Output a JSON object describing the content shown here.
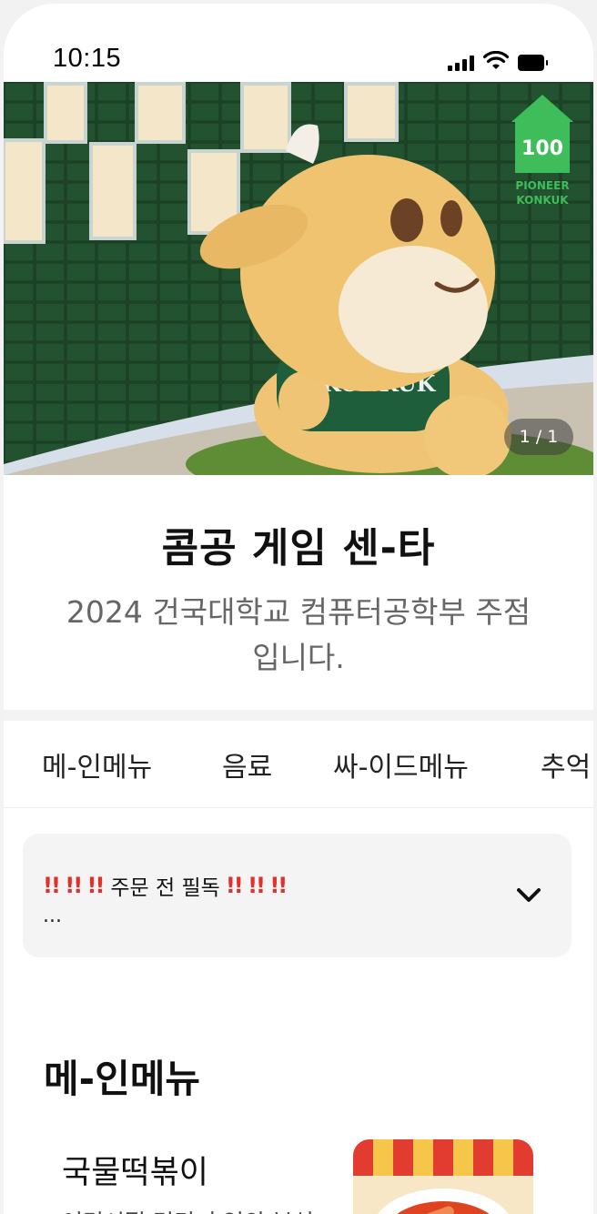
{
  "status_bar": {
    "time": "10:15"
  },
  "hero": {
    "pager": "1 / 1",
    "logo_badge": "PIONEER KONKUK"
  },
  "store": {
    "title": "콤공 게임 센-타",
    "description": "2024 건국대학교 컴퓨터공학부 주점입니다."
  },
  "tabs": [
    {
      "label": "메-인메뉴"
    },
    {
      "label": "음료"
    },
    {
      "label": "싸-이드메뉴"
    },
    {
      "label": "추억"
    }
  ],
  "notice": {
    "marks": "!! !! !!",
    "text": "주문 전 필독",
    "more": "..."
  },
  "section": {
    "title": "메-인메뉴"
  },
  "menu_items": [
    {
      "name": "국물떡볶이",
      "description": "어린시절 먹던 추억의 분식"
    }
  ],
  "colors": {
    "accent_red": "#e0312b",
    "tile_green": "#1f4a2a"
  }
}
